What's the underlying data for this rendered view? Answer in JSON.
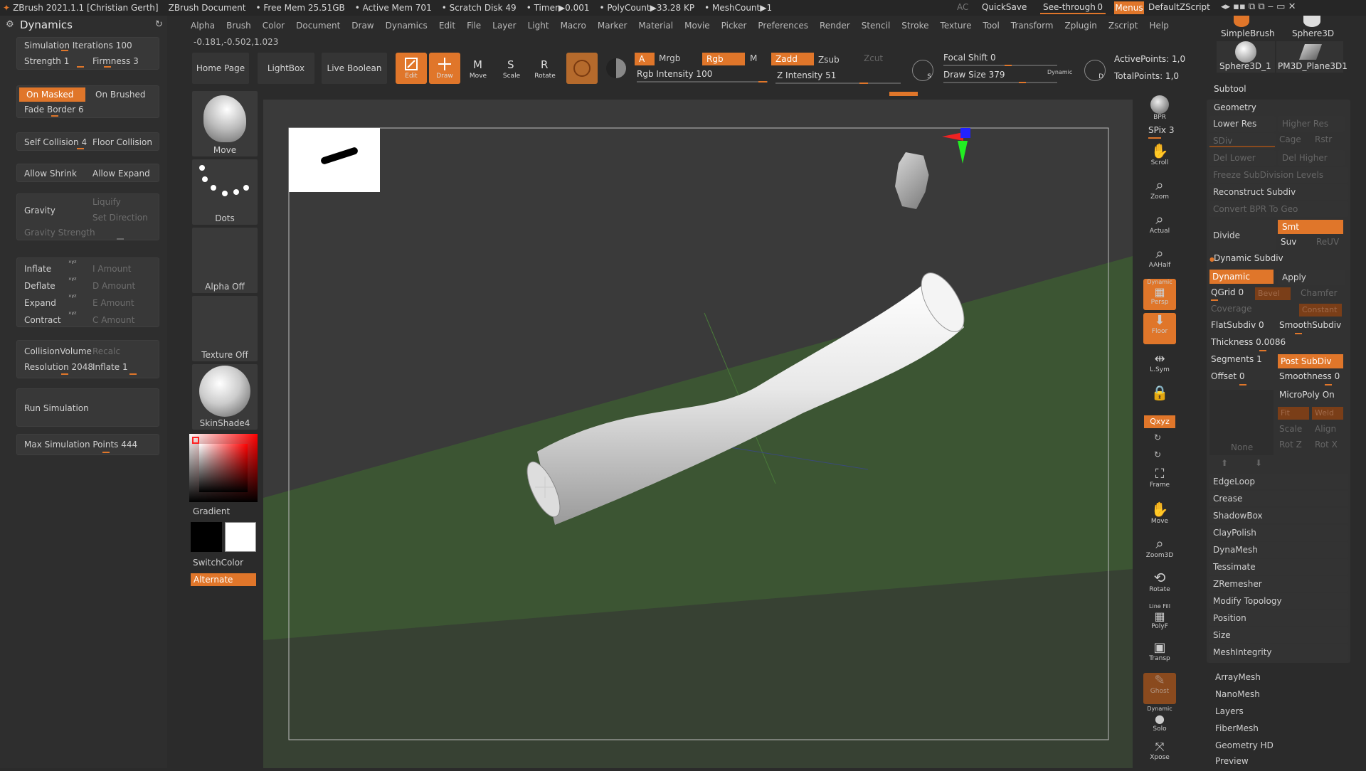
{
  "titlebar": {
    "app": "ZBrush 2021.1.1 [Christian Gerth]",
    "document": "ZBrush Document",
    "free_mem": "• Free Mem 25.51GB",
    "active_mem": "• Active Mem 701",
    "scratch": "• Scratch Disk 49",
    "timer": "• Timer▶0.001",
    "polycount": "• PolyCount▶33.28 KP",
    "meshcount": "• MeshCount▶1",
    "ac": "AC",
    "quicksave": "QuickSave",
    "seethrough": "See-through",
    "seethrough_val": "0",
    "menus": "Menus",
    "script": "DefaultZScript"
  },
  "menubar": [
    "Alpha",
    "Brush",
    "Color",
    "Document",
    "Draw",
    "Dynamics",
    "Edit",
    "File",
    "Layer",
    "Light",
    "Macro",
    "Marker",
    "Material",
    "Movie",
    "Picker",
    "Preferences",
    "Render",
    "Stencil",
    "Stroke",
    "Texture",
    "Tool",
    "Transform",
    "Zplugin",
    "Zscript",
    "Help"
  ],
  "coords": "-0.181,-0.502,1.023",
  "left": {
    "title": "Dynamics",
    "sim_iter": "Simulation Iterations 100",
    "strength": "Strength 1",
    "firmness": "Firmness 3",
    "on_masked": "On Masked",
    "on_brushed": "On Brushed",
    "fade_border": "Fade Border 6",
    "self_collision": "Self Collision 4",
    "floor_collision": "Floor Collision",
    "allow_shrink": "Allow Shrink",
    "allow_expand": "Allow Expand",
    "gravity": "Gravity",
    "liquify": "Liquify",
    "set_direction": "Set Direction",
    "gravity_strength": "Gravity Strength",
    "inflate": "Inflate",
    "deflate": "Deflate",
    "expand": "Expand",
    "contract": "Contract",
    "xyz": "ˣʸᶻ",
    "i_amount": "I Amount",
    "d_amount": "D Amount",
    "e_amount": "E Amount",
    "c_amount": "C Amount",
    "collision_volume": "CollisionVolume",
    "recalc": "Recalc",
    "resolution": "Resolution 2048",
    "inflate1": "Inflate 1",
    "run_sim": "Run Simulation",
    "max_points": "Max Simulation Points 444"
  },
  "shelf": {
    "home": "Home Page",
    "lightbox": "LightBox",
    "live_boolean": "Live Boolean",
    "edit": "Edit",
    "draw": "Draw",
    "move": "Move",
    "scale": "Scale",
    "rotate": "Rotate",
    "a": "A",
    "mrgb": "Mrgb",
    "rgb": "Rgb",
    "m": "M",
    "rgb_intensity": "Rgb Intensity 100",
    "zadd": "Zadd",
    "zsub": "Zsub",
    "zcut": "Zcut",
    "z_intensity": "Z Intensity 51",
    "focal_shift": "Focal Shift 0",
    "draw_size": "Draw Size 379",
    "dynamic": "Dynamic",
    "active_points": "ActivePoints: 1,0",
    "total_points": "TotalPoints: 1,0",
    "s_label": "S",
    "d_label": "D"
  },
  "thumbs": {
    "move": "Move",
    "dots": "Dots",
    "alpha": "Alpha Off",
    "texture": "Texture Off",
    "material": "SkinShade4",
    "gradient": "Gradient",
    "switchcolor": "SwitchColor",
    "alternate": "Alternate"
  },
  "righttools": {
    "bpr": "BPR",
    "spix": "SPix 3",
    "scroll": "Scroll",
    "zoom": "Zoom",
    "actual": "Actual",
    "aahalf": "AAHalf",
    "dynamic": "Dynamic",
    "persp": "Persp",
    "floor": "Floor",
    "lsym": "L.Sym",
    "xyz": "Qxyz",
    "frame": "Frame",
    "move": "Move",
    "zoom3d": "Zoom3D",
    "rotate": "Rotate",
    "linefill": "Line Fill",
    "polyf": "PolyF",
    "transp": "Transp",
    "ghost": "Ghost",
    "solo": "Solo",
    "xpose": "Xpose"
  },
  "right": {
    "simplebrush": "SimpleBrush",
    "sphere3d": "Sphere3D",
    "sphere3d_1": "Sphere3D_1",
    "pm3d": "PM3D_Plane3D1",
    "subtool": "Subtool",
    "geometry": "Geometry",
    "lower_res": "Lower Res",
    "higher_res": "Higher Res",
    "sdiv": "SDiv",
    "cage": "Cage",
    "rstr": "Rstr",
    "del_lower": "Del Lower",
    "del_higher": "Del Higher",
    "freeze": "Freeze SubDivision Levels",
    "reconstruct": "Reconstruct Subdiv",
    "convert_bpr": "Convert BPR To Geo",
    "divide": "Divide",
    "smt": "Smt",
    "suv": "Suv",
    "reuv": "ReUV",
    "dynamic_subdiv": "Dynamic Subdiv",
    "dynamic": "Dynamic",
    "apply": "Apply",
    "qgrid": "QGrid 0",
    "bevel": "Bevel",
    "chamfer": "Chamfer",
    "coverage": "Coverage",
    "constant": "Constant",
    "flatsubdiv": "FlatSubdiv 0",
    "smoothsubdiv": "SmoothSubdiv",
    "thickness": "Thickness 0.0086",
    "segments": "Segments 1",
    "post_subdiv": "Post SubDiv",
    "offset": "Offset 0",
    "smoothness": "Smoothness 0",
    "micropoly": "MicroPoly On",
    "fit": "Fit",
    "weld": "Weld",
    "scale": "Scale",
    "align": "Align",
    "rotz": "Rot Z",
    "rotx": "Rot X",
    "none": "None",
    "items": [
      "EdgeLoop",
      "Crease",
      "ShadowBox",
      "ClayPolish",
      "DynaMesh",
      "Tessimate",
      "ZRemesher",
      "Modify Topology",
      "Position",
      "Size",
      "MeshIntegrity"
    ],
    "items2": [
      "ArrayMesh",
      "NanoMesh",
      "Layers",
      "FiberMesh",
      "Geometry HD",
      "Preview"
    ]
  },
  "colors": {
    "accent": "#e0762a",
    "panel": "#383838",
    "bg": "#2b2b2b",
    "floor": "#3d5a33"
  }
}
